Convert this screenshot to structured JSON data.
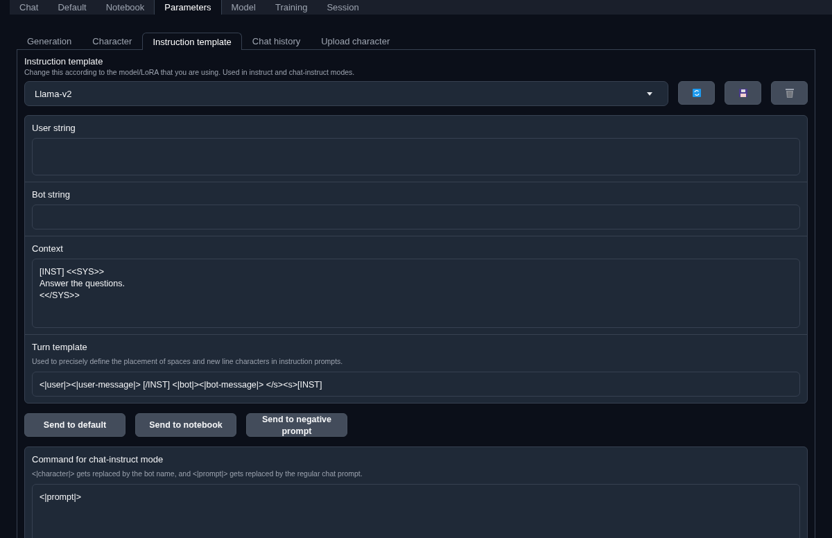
{
  "top_tabs": [
    {
      "label": "Chat",
      "selected": false
    },
    {
      "label": "Default",
      "selected": false
    },
    {
      "label": "Notebook",
      "selected": false
    },
    {
      "label": "Parameters",
      "selected": true
    },
    {
      "label": "Model",
      "selected": false
    },
    {
      "label": "Training",
      "selected": false
    },
    {
      "label": "Session",
      "selected": false
    }
  ],
  "sub_tabs": [
    {
      "label": "Generation",
      "selected": false
    },
    {
      "label": "Character",
      "selected": false
    },
    {
      "label": "Instruction template",
      "selected": true
    },
    {
      "label": "Chat history",
      "selected": false
    },
    {
      "label": "Upload character",
      "selected": false
    }
  ],
  "template": {
    "label": "Instruction template",
    "info": "Change this according to the model/LoRA that you are using. Used in instruct and chat-instruct modes.",
    "dropdown": {
      "value": "Llama-v2"
    }
  },
  "fields": [
    {
      "label": "User string"
    },
    {
      "label": "Bot string"
    },
    {
      "label": "Context",
      "value": "[INST] <<SYS>>\nAnswer the questions.\n<</SYS>>"
    },
    {
      "label": "Turn template",
      "info": "Used to precisely define the placement of spaces and new line characters in instruction prompts.",
      "value": "<|user|><|user-message|> [/INST] <|bot|><|bot-message|> </s><s>[INST]"
    }
  ],
  "buttons": [
    "Send to default",
    "Send to notebook",
    "Send to negative prompt"
  ],
  "command": {
    "label": "Command for chat-instruct mode",
    "info": "<|character|> gets replaced by the bot name, and <|prompt|> gets replaced by the regular chat prompt.",
    "value": "<|prompt|>"
  }
}
